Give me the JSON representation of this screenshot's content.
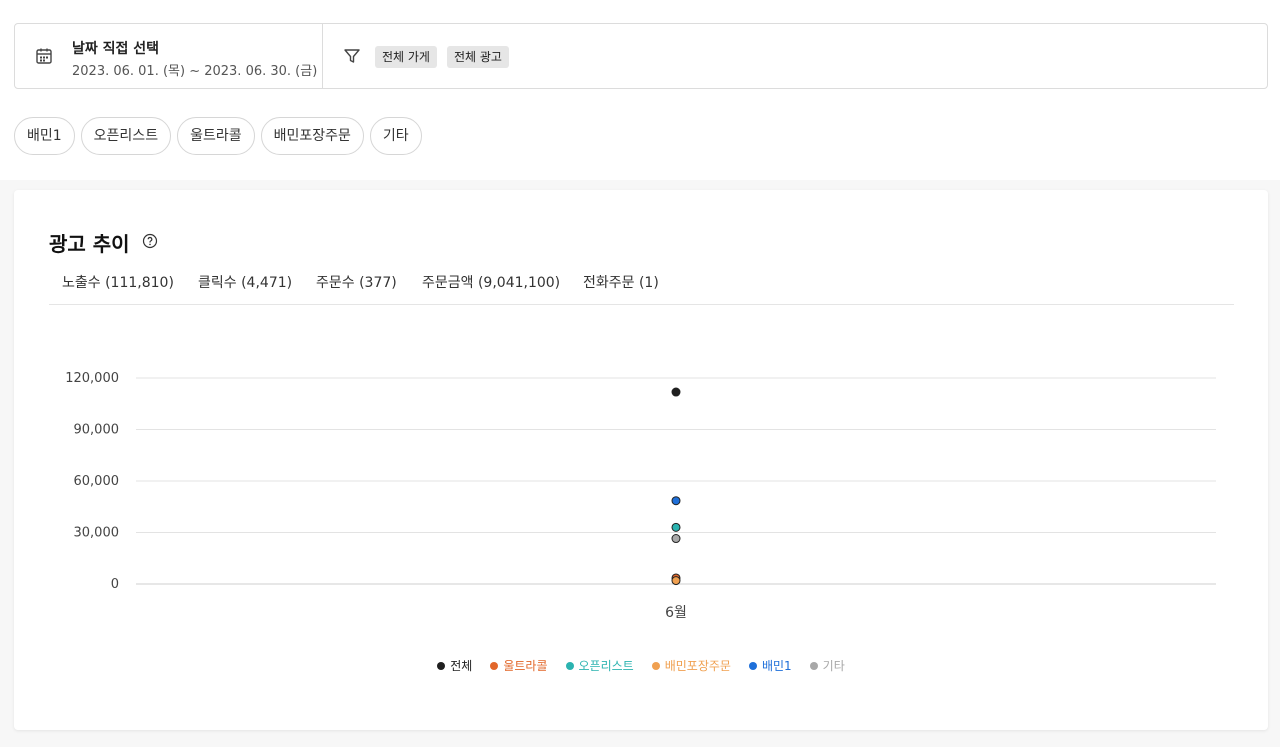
{
  "filter": {
    "date_title": "날짜 직접 선택",
    "date_range": "2023. 06. 01. (목) ~ 2023. 06. 30. (금)",
    "tags": [
      "전체 가게",
      "전체 광고"
    ]
  },
  "chips": [
    "배민1",
    "오픈리스트",
    "울트라콜",
    "배민포장주문",
    "기타"
  ],
  "card": {
    "title": "광고 추이",
    "tabs": [
      "노출수 (111,810)",
      "클릭수 (4,471)",
      "주문수 (377)",
      "주문금액 (9,041,100)",
      "전화주문 (1)"
    ]
  },
  "colors": {
    "total": "#1f1f1f",
    "ultracall": "#e2672a",
    "openlist": "#2bb3b0",
    "baemin_pickup": "#f0a050",
    "baemin1": "#1e6fd9",
    "etc": "#a8a8a8"
  },
  "chart_data": {
    "type": "scatter",
    "categories": [
      "6월"
    ],
    "ylim": [
      0,
      120000
    ],
    "yticks": [
      0,
      30000,
      60000,
      90000,
      120000
    ],
    "ytick_labels": [
      "0",
      "30,000",
      "60,000",
      "90,000",
      "120,000"
    ],
    "legend_position": "bottom",
    "grid": true,
    "series": [
      {
        "name": "전체",
        "values": [
          111810
        ],
        "color": "#1f1f1f"
      },
      {
        "name": "울트라콜",
        "values": [
          3500
        ],
        "color": "#e2672a"
      },
      {
        "name": "오픈리스트",
        "values": [
          33000
        ],
        "color": "#2bb3b0"
      },
      {
        "name": "배민포장주문",
        "values": [
          2000
        ],
        "color": "#f0a050"
      },
      {
        "name": "배민1",
        "values": [
          48500
        ],
        "color": "#1e6fd9"
      },
      {
        "name": "기타",
        "values": [
          26500
        ],
        "color": "#a8a8a8"
      }
    ]
  }
}
